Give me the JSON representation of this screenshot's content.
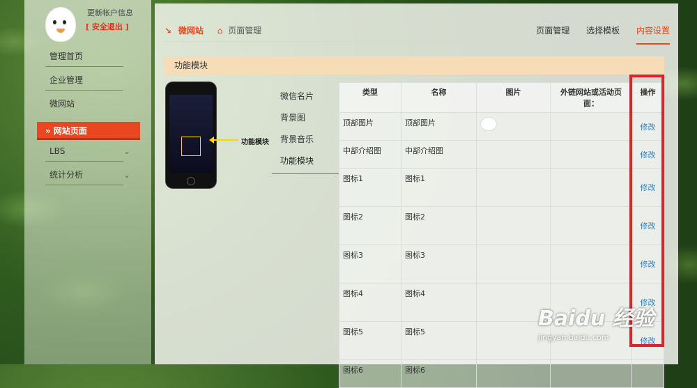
{
  "profile": {
    "update_label": "更新帐户信息",
    "logout_label": "[ 安全退出 ]"
  },
  "nav": {
    "items": [
      {
        "label": "管理首页",
        "chevron": ""
      },
      {
        "label": "企业管理",
        "chevron": ""
      },
      {
        "label": "微网站",
        "chevron": ""
      },
      {
        "label": "LBS",
        "chevron": "⌄"
      },
      {
        "label": "统计分析",
        "chevron": "⌄"
      }
    ],
    "active_label": "» 网站页面"
  },
  "breadcrumb": {
    "site": "微网站",
    "page": "页面管理"
  },
  "tabs": [
    "页面管理",
    "选择模板",
    "内容设置"
  ],
  "section_title": "功能模块",
  "phone_callout": "功能模块",
  "submenu": [
    "微信名片",
    "背景图",
    "背景音乐",
    "功能模块"
  ],
  "table": {
    "headers": [
      "类型",
      "名称",
      "图片",
      "外链网站或活动页面：",
      "操作"
    ],
    "rows": [
      {
        "type": "顶部图片",
        "name": "顶部图片",
        "link": "",
        "action": "修改"
      },
      {
        "type": "中部介绍图",
        "name": "中部介绍图",
        "link": "",
        "action": "修改"
      },
      {
        "type": "图标1",
        "name": "图标1",
        "link": "",
        "action": "修改"
      },
      {
        "type": "图标2",
        "name": "图标2",
        "link": "",
        "action": "修改"
      },
      {
        "type": "图标3",
        "name": "图标3",
        "link": "",
        "action": "修改"
      },
      {
        "type": "图标4",
        "name": "图标4",
        "link": "",
        "action": "修改"
      },
      {
        "type": "图标5",
        "name": "图标5",
        "link": "",
        "action": "修改"
      },
      {
        "type": "图标6",
        "name": "图标6",
        "link": "",
        "action": ""
      }
    ]
  },
  "watermark": {
    "logo": "Baidu 经验",
    "url": "jingyan.baidu.com"
  },
  "colors": {
    "accent": "#e8471f",
    "highlight_box": "#e6202a",
    "link": "#2a7dc0"
  }
}
